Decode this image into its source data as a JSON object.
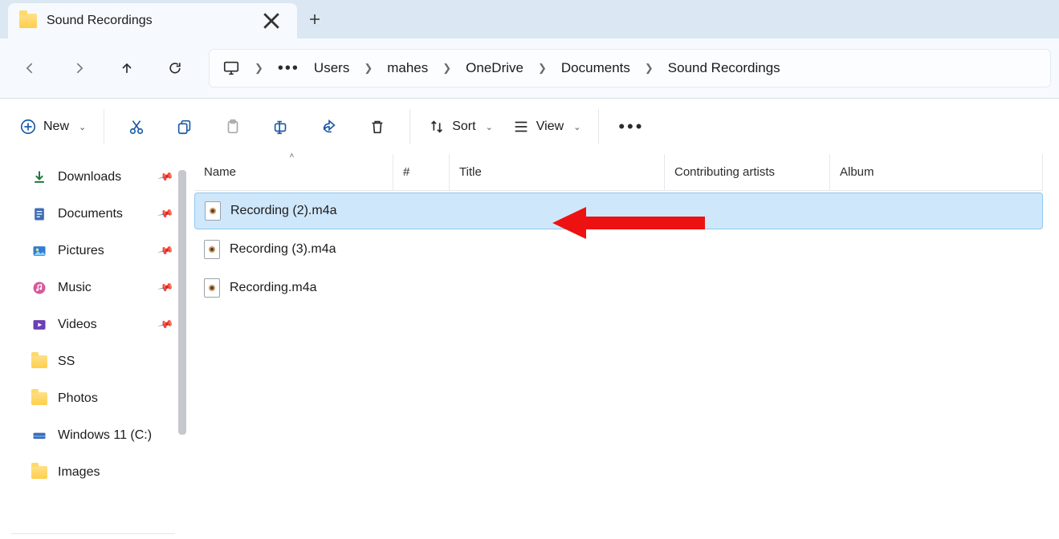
{
  "tab": {
    "title": "Sound Recordings"
  },
  "breadcrumb": {
    "segments": [
      "Users",
      "mahes",
      "OneDrive",
      "Documents",
      "Sound Recordings"
    ]
  },
  "toolbar": {
    "new_label": "New",
    "sort_label": "Sort",
    "view_label": "View"
  },
  "sidebar": {
    "items": [
      {
        "label": "Downloads",
        "pinned": true,
        "icon": "download"
      },
      {
        "label": "Documents",
        "pinned": true,
        "icon": "doc"
      },
      {
        "label": "Pictures",
        "pinned": true,
        "icon": "pic"
      },
      {
        "label": "Music",
        "pinned": true,
        "icon": "music"
      },
      {
        "label": "Videos",
        "pinned": true,
        "icon": "video"
      },
      {
        "label": "SS",
        "pinned": false,
        "icon": "folder"
      },
      {
        "label": "Photos",
        "pinned": false,
        "icon": "folder"
      },
      {
        "label": "Windows 11 (C:)",
        "pinned": false,
        "icon": "drive"
      },
      {
        "label": "Images",
        "pinned": false,
        "icon": "folder"
      }
    ]
  },
  "columns": {
    "name": "Name",
    "num": "#",
    "title": "Title",
    "artist": "Contributing artists",
    "album": "Album"
  },
  "files": [
    {
      "name": "Recording (2).m4a",
      "selected": true
    },
    {
      "name": "Recording (3).m4a",
      "selected": false
    },
    {
      "name": "Recording.m4a",
      "selected": false
    }
  ]
}
